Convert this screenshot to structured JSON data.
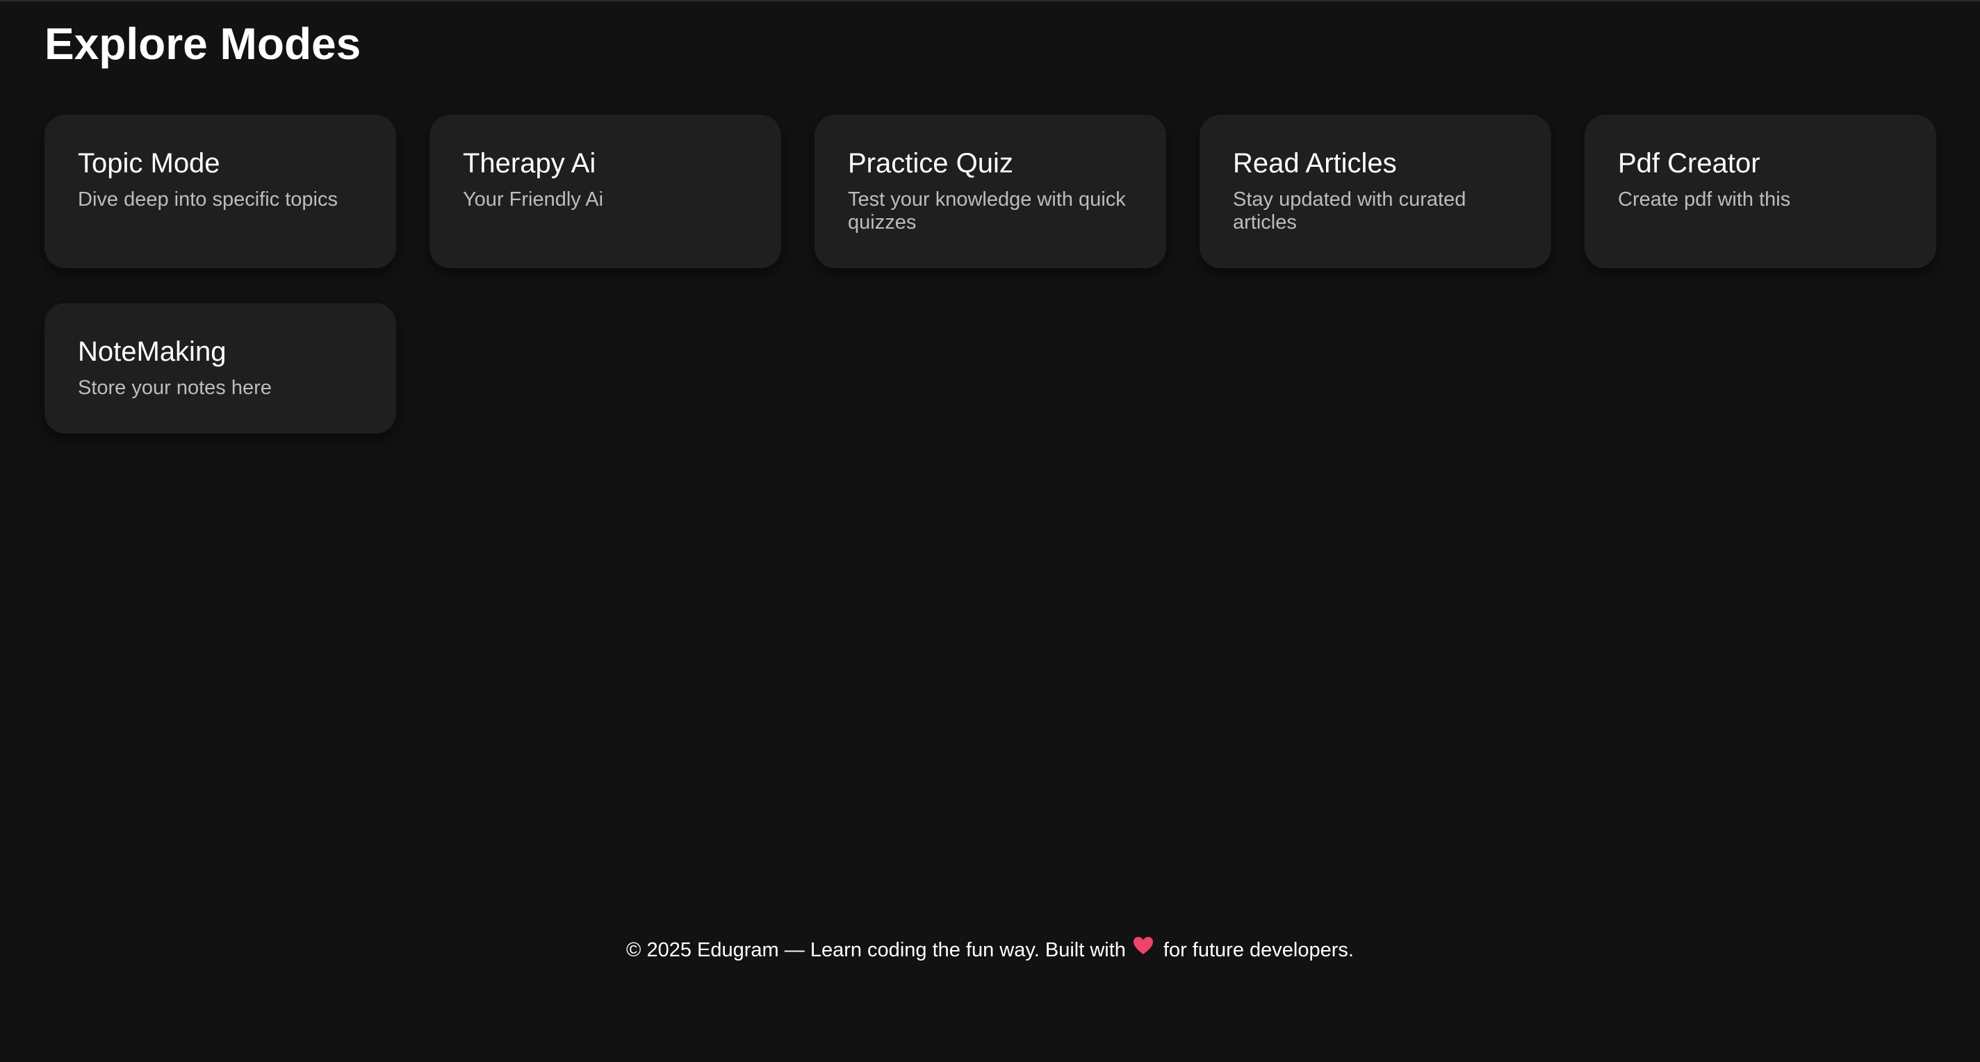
{
  "page": {
    "title": "Explore Modes"
  },
  "cards": [
    {
      "title": "Topic Mode",
      "description": "Dive deep into specific topics"
    },
    {
      "title": "Therapy Ai",
      "description": "Your Friendly Ai"
    },
    {
      "title": "Practice Quiz",
      "description": "Test your knowledge with quick quizzes"
    },
    {
      "title": "Read Articles",
      "description": "Stay updated with curated articles"
    },
    {
      "title": "Pdf Creator",
      "description": "Create pdf with this"
    },
    {
      "title": "NoteMaking",
      "description": "Store your notes here"
    }
  ],
  "footer": {
    "text_before": "© 2025 Edugram — Learn coding the fun way. Built with",
    "icon": "heart-icon",
    "text_after": "for future developers."
  },
  "colors": {
    "background": "#121212",
    "card": "#1f1f1f",
    "heart": "#f0436a"
  }
}
